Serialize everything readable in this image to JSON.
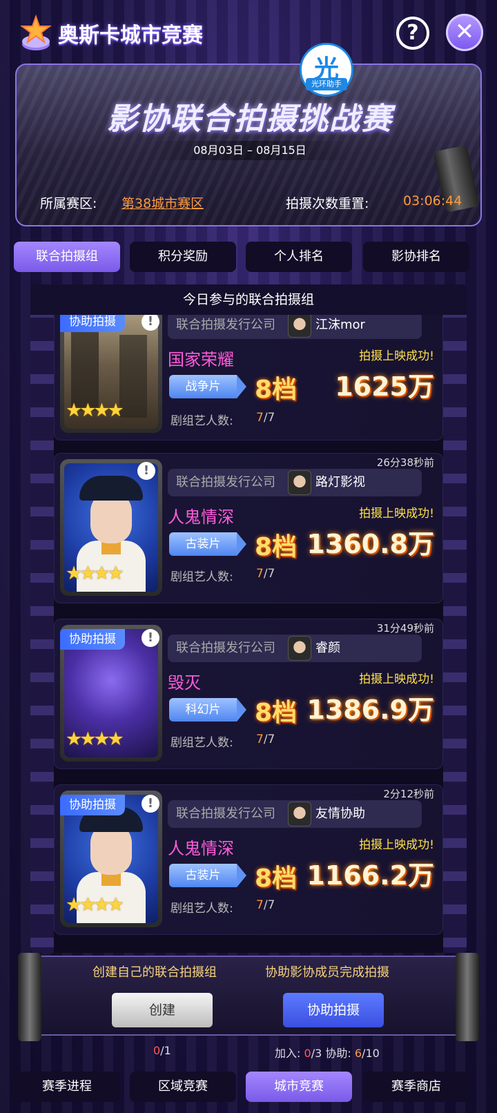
{
  "header": {
    "title": "奥斯卡城市竞赛",
    "help_label": "?",
    "close_label": "✕"
  },
  "banner": {
    "badge_glyph": "光",
    "badge_text": "光环助手",
    "title": "影协联合拍摄挑战赛",
    "dates": "08月03日 – 08月15日",
    "zone_label": "所属赛区:",
    "zone_value": "第38城市赛区",
    "reset_label": "拍摄次数重置:",
    "reset_value": "03:06:44"
  },
  "tabs_top": [
    {
      "label": "联合拍摄组",
      "active": true
    },
    {
      "label": "积分奖励",
      "active": false
    },
    {
      "label": "个人排名",
      "active": false
    },
    {
      "label": "影协排名",
      "active": false
    }
  ],
  "list": {
    "header": "今日参与的联合拍摄组",
    "company_label": "联合拍摄发行公司",
    "crew_label": "剧组艺人数:",
    "success_text": "拍摄上映成功!",
    "stars": "★★★★",
    "cards": [
      {
        "assist_tag": "协助拍摄",
        "time_ago": "",
        "company": "江沫mor",
        "title": "国家荣耀",
        "genre": "战争片",
        "tier": "8档",
        "box_office": "1625万",
        "crew_current": "7",
        "crew_total": "/7"
      },
      {
        "assist_tag": "",
        "time_ago": "26分38秒前",
        "company": "路灯影视",
        "title": "人鬼情深",
        "genre": "古装片",
        "tier": "8档",
        "box_office": "1360.8万",
        "crew_current": "7",
        "crew_total": "/7"
      },
      {
        "assist_tag": "协助拍摄",
        "time_ago": "31分49秒前",
        "company": "睿颜",
        "title": "毁灭",
        "genre": "科幻片",
        "tier": "8档",
        "box_office": "1386.9万",
        "crew_current": "7",
        "crew_total": "/7"
      },
      {
        "assist_tag": "协助拍摄",
        "time_ago": "2分12秒前",
        "company": "友情协助",
        "title": "人鬼情深",
        "genre": "古装片",
        "tier": "8档",
        "box_office": "1166.2万",
        "crew_current": "7",
        "crew_total": "/7"
      }
    ]
  },
  "action": {
    "create_text": "创建自己的联合拍摄组",
    "assist_text": "协助影协成员完成拍摄",
    "create_button": "创建",
    "assist_button": "协助拍摄",
    "create_count_current": "0",
    "create_count_total": "/1",
    "join_label": "加入:",
    "join_current": "0",
    "join_total": "/3",
    "assist_label": "协助:",
    "assist_current": "6",
    "assist_total": "/10"
  },
  "tabs_bottom": [
    {
      "label": "赛季进程",
      "active": false
    },
    {
      "label": "区域竞赛",
      "active": false
    },
    {
      "label": "城市竞赛",
      "active": true
    },
    {
      "label": "赛季商店",
      "active": false
    }
  ]
}
